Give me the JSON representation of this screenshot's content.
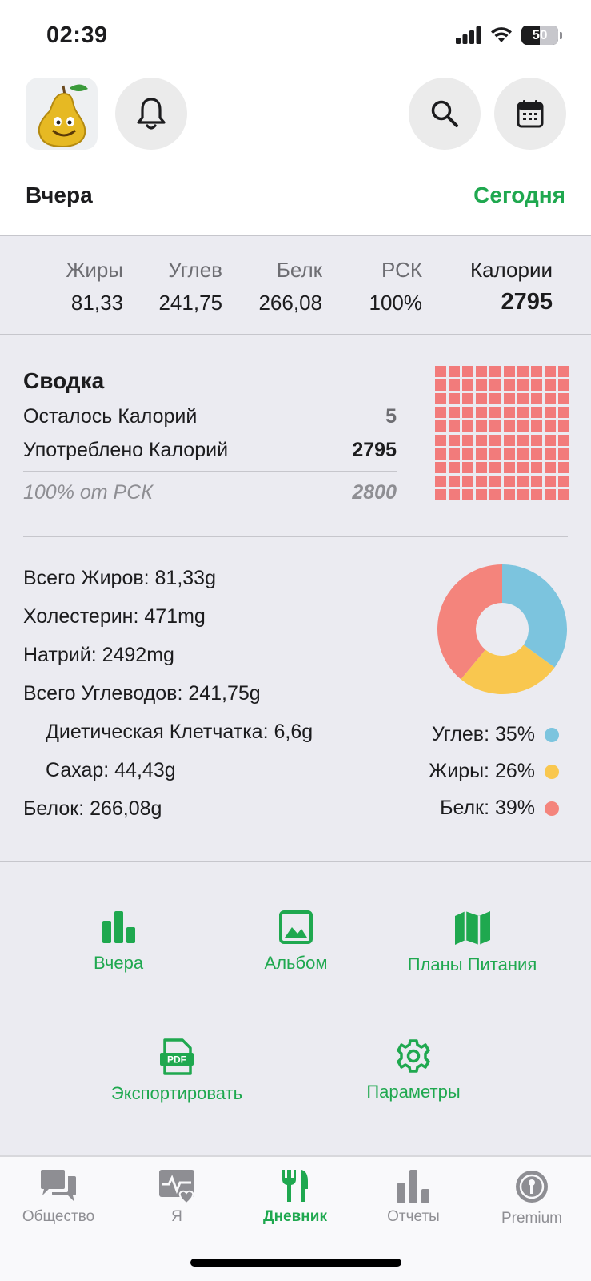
{
  "status": {
    "time": "02:39",
    "battery": "50"
  },
  "header": {
    "left_title": "Вчера",
    "right_link": "Сегодня"
  },
  "macros": [
    {
      "name": "Жиры",
      "value": "81,33"
    },
    {
      "name": "Углев",
      "value": "241,75"
    },
    {
      "name": "Белк",
      "value": "266,08"
    },
    {
      "name": "РСК",
      "value": "100%"
    }
  ],
  "calories": {
    "label": "Калории",
    "value": "2795"
  },
  "summary": {
    "title": "Сводка",
    "remaining_label": "Осталось Калорий",
    "remaining_value": "5",
    "consumed_label": "Употреблено Калорий",
    "consumed_value": "2795",
    "percent_label": "100% от РСК",
    "target_value": "2800",
    "grid_fill": 1.0
  },
  "nutrients": {
    "fat": "Всего Жиров: 81,33g",
    "cholesterol": "Холестерин: 471mg",
    "sodium": "Натрий: 2492mg",
    "carbs": "Всего Углеводов: 241,75g",
    "fiber": "Диетическая Клетчатка: 6,6g",
    "sugar": "Сахар: 44,43g",
    "protein": "Белок: 266,08g"
  },
  "chart_data": {
    "type": "pie",
    "categories": [
      "Углев",
      "Жиры",
      "Белк"
    ],
    "values": [
      35,
      26,
      39
    ],
    "colors": [
      "#7cc4de",
      "#f9c74f",
      "#f4847c"
    ],
    "legend": [
      "Углев: 35%",
      "Жиры: 26%",
      "Белк: 39%"
    ]
  },
  "tiles": {
    "yesterday": "Вчера",
    "album": "Альбом",
    "plans": "Планы Питания",
    "export": "Экспортировать",
    "settings": "Параметры"
  },
  "tabs": {
    "community": "Общество",
    "me": "Я",
    "diary": "Дневник",
    "reports": "Отчеты",
    "premium": "Premium"
  },
  "colors": {
    "accent": "#1fa84f",
    "grid": "#f27b7b"
  }
}
